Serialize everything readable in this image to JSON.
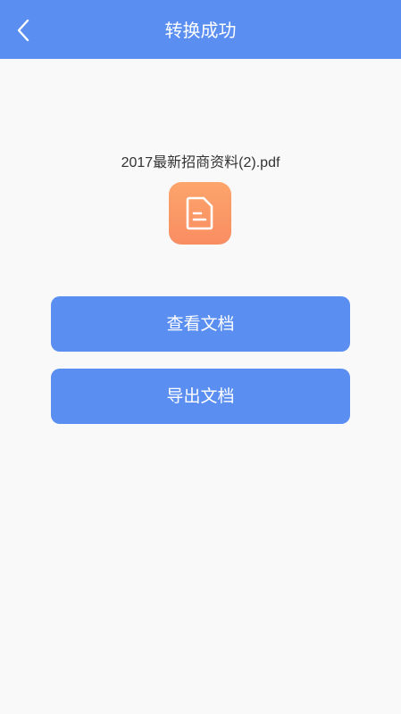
{
  "header": {
    "title": "转换成功",
    "back_icon": "chevron-left-icon"
  },
  "file": {
    "name": "2017最新招商资料(2).pdf",
    "icon": "document-icon"
  },
  "actions": {
    "view_label": "查看文档",
    "export_label": "导出文档"
  },
  "colors": {
    "primary": "#5a8ef1",
    "background": "#f9f9f9",
    "file_icon_top": "#fca56b",
    "file_icon_bottom": "#f98d62"
  }
}
